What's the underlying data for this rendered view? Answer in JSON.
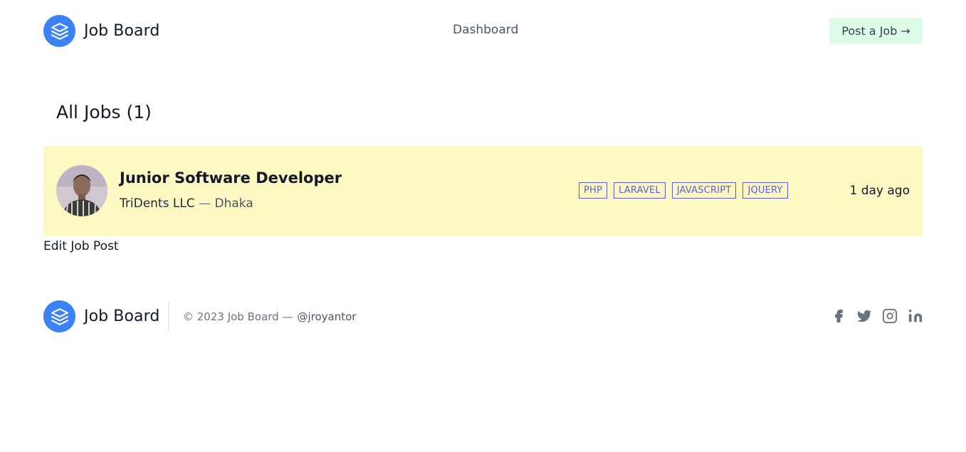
{
  "header": {
    "brand": "Job Board",
    "nav_dashboard": "Dashboard",
    "post_job_label": "Post a Job",
    "post_job_arrow": "→"
  },
  "main": {
    "title": "All Jobs (1)",
    "jobs": [
      {
        "title": "Junior Software Developer",
        "company": "TriDents LLC",
        "separator": "—",
        "location": "Dhaka",
        "tags": [
          "PHP",
          "LARAVEL",
          "JAVASCRIPT",
          "JQUERY"
        ],
        "posted": "1 day ago"
      }
    ],
    "edit_link": "Edit Job Post"
  },
  "footer": {
    "brand": "Job Board",
    "copyright": "© 2023 Job Board —",
    "handle": "@jroyantor",
    "social_icons": [
      "facebook-icon",
      "twitter-icon",
      "instagram-icon",
      "linkedin-icon"
    ]
  },
  "colors": {
    "brand_blue": "#3b82f6",
    "post_button_bg": "#dcfce7",
    "job_card_bg": "#fef9c3",
    "tag_color": "#5b5fd6"
  }
}
